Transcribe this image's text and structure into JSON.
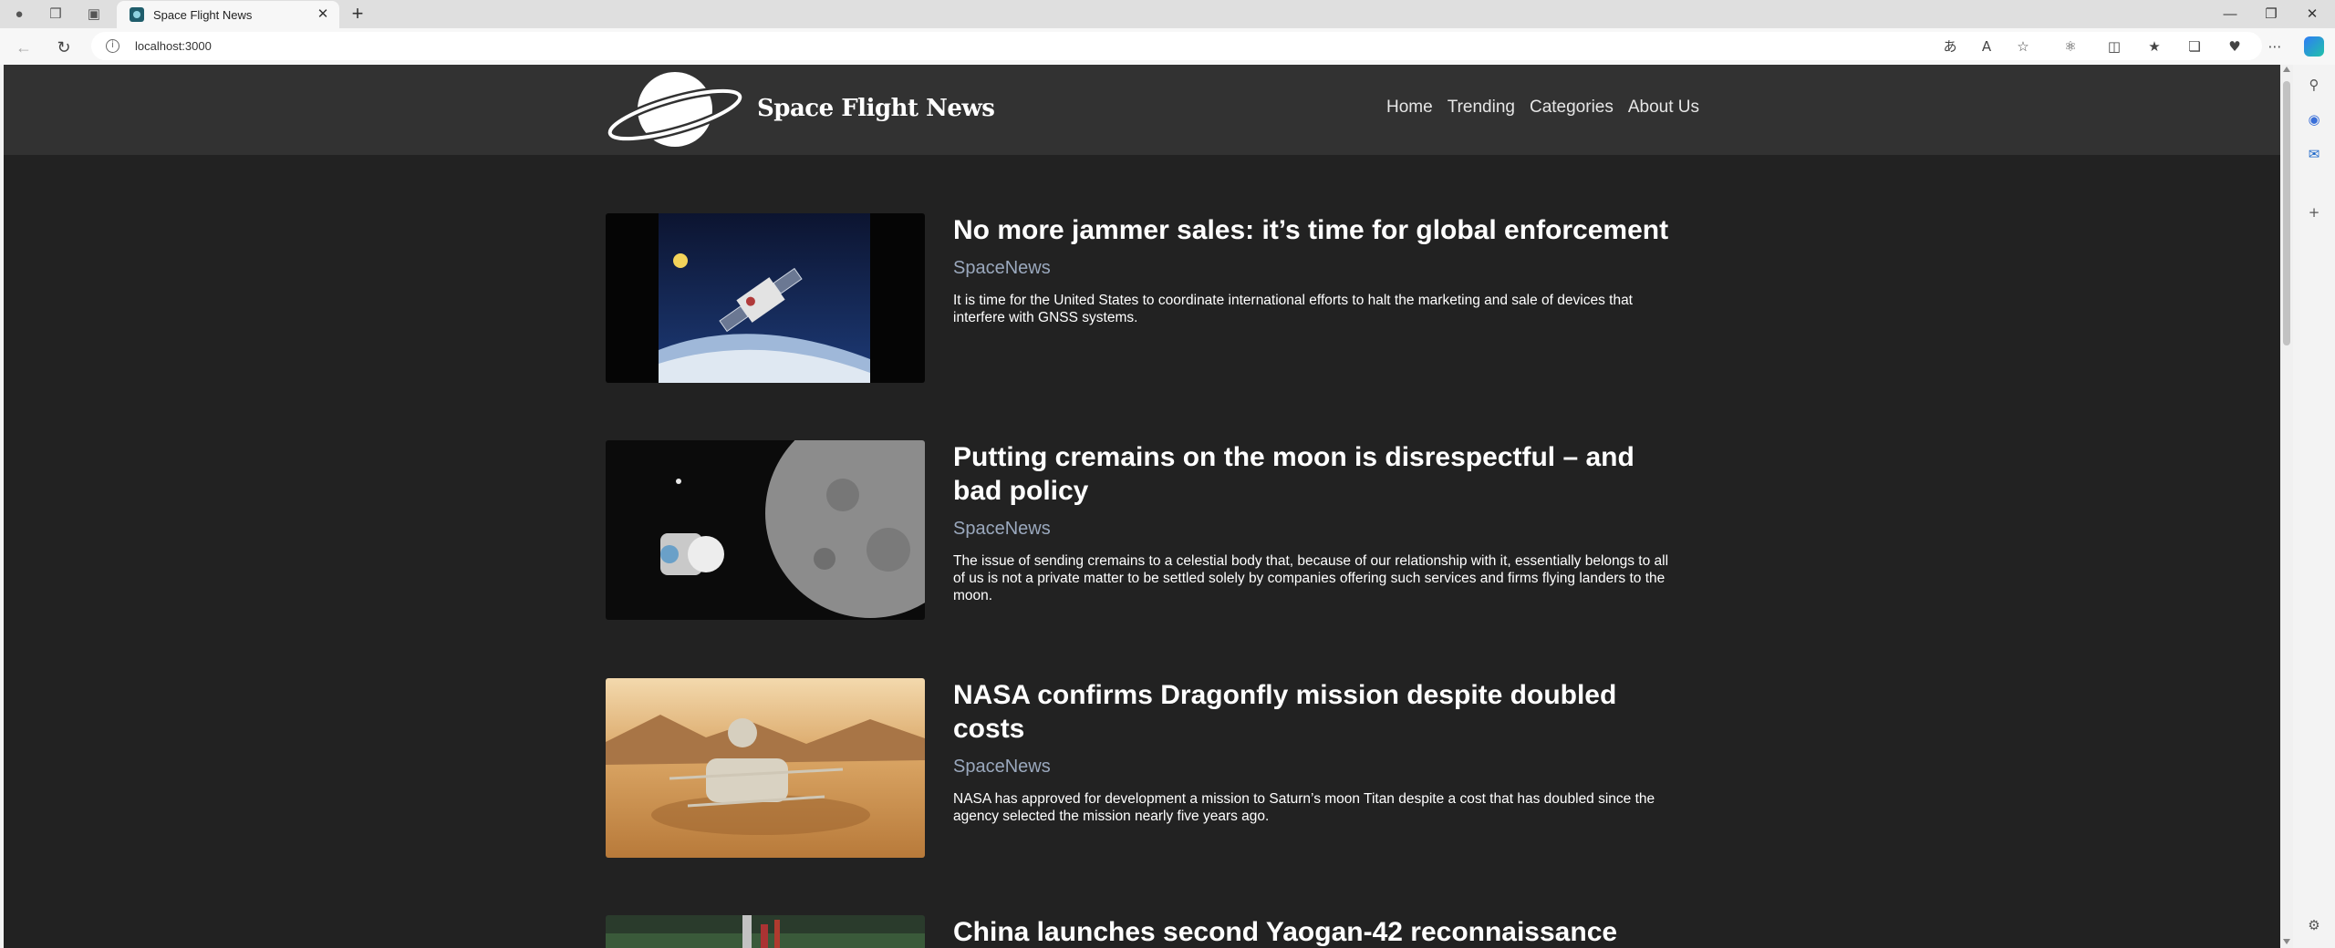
{
  "browser": {
    "tab_title": "Space Flight News",
    "url": "localhost:3000"
  },
  "site": {
    "title": "Space Flight News",
    "nav": [
      "Home",
      "Trending",
      "Categories",
      "About Us"
    ]
  },
  "articles": [
    {
      "title": "No more jammer sales: it’s time for global enforcement",
      "source": "SpaceNews",
      "summary": "It is time for the United States to coordinate international efforts to halt the marketing and sale of devices that interfere with GNSS systems."
    },
    {
      "title": "Putting cremains on the moon is disrespectful – and bad policy",
      "source": "SpaceNews",
      "summary": "The issue of sending cremains to a celestial body that, because of our relationship with it, essentially belongs to all of us is not a private matter to be settled solely by companies offering such services and firms flying landers to the moon."
    },
    {
      "title": "NASA confirms Dragonfly mission despite doubled costs",
      "source": "SpaceNews",
      "summary": "NASA has approved for development a mission to Saturn’s moon Titan despite a cost that has doubled since the agency selected the mission nearly five years ago."
    },
    {
      "title": "China launches second Yaogan-42 reconnaissance",
      "source": "",
      "summary": ""
    }
  ],
  "colors": {
    "page_bg": "#222222",
    "header_bg": "#323232",
    "source_text": "#9aa8bd"
  }
}
